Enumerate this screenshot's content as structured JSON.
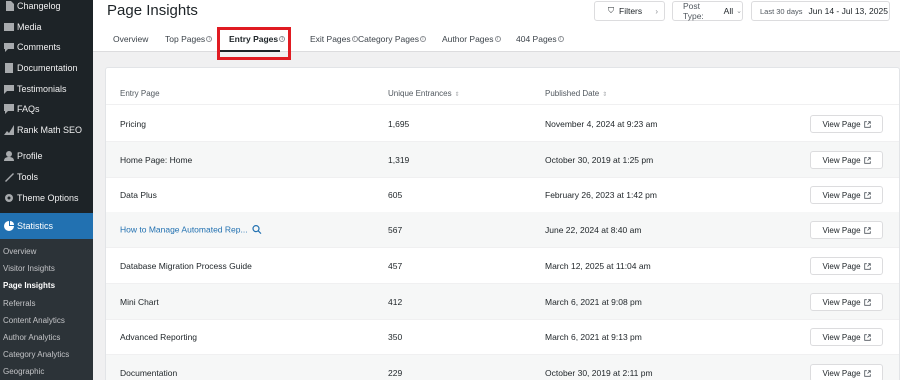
{
  "sidebar": {
    "items": [
      {
        "label": "Changelog",
        "icon": "changelog-icon"
      },
      {
        "label": "Media",
        "icon": "media-icon"
      },
      {
        "label": "Comments",
        "icon": "comments-icon"
      },
      {
        "label": "Documentation",
        "icon": "documentation-icon"
      },
      {
        "label": "Testimonials",
        "icon": "testimonials-icon"
      },
      {
        "label": "FAQs",
        "icon": "faqs-icon"
      },
      {
        "label": "Rank Math SEO",
        "icon": "rank-math-icon"
      },
      {
        "label": "Profile",
        "icon": "profile-icon"
      },
      {
        "label": "Tools",
        "icon": "tools-icon"
      },
      {
        "label": "Theme Options",
        "icon": "gear-icon"
      }
    ],
    "active": {
      "label": "Statistics",
      "icon": "statistics-icon"
    },
    "submenu": [
      "Overview",
      "Visitor Insights",
      "Page Insights",
      "Referrals",
      "Content Analytics",
      "Author Analytics",
      "Category Analytics",
      "Geographic"
    ],
    "current_submenu": "Page Insights"
  },
  "header": {
    "title": "Page Insights",
    "filters_label": "Filters",
    "post_type_label": "Post Type:",
    "post_type_value": "All",
    "date_preset": "Last 30 days",
    "date_range": "Jun 14 - Jul 13, 2025"
  },
  "tabs": [
    {
      "label": "Overview",
      "info": false
    },
    {
      "label": "Top Pages",
      "info": true
    },
    {
      "label": "Entry Pages",
      "info": true,
      "active": true
    },
    {
      "label": "Exit Pages",
      "info": true
    },
    {
      "label": "Category Pages",
      "info": true
    },
    {
      "label": "Author Pages",
      "info": true
    },
    {
      "label": "404 Pages",
      "info": true
    }
  ],
  "table": {
    "columns": [
      "Entry Page",
      "Unique Entrances",
      "Published Date"
    ],
    "view_label": "View Page",
    "rows": [
      {
        "page": "Pricing",
        "entrances": "1,695",
        "date": "November 4, 2024 at 9:23 am"
      },
      {
        "page": "Home Page: Home",
        "entrances": "1,319",
        "date": "October 30, 2019 at 1:25 pm"
      },
      {
        "page": "Data Plus",
        "entrances": "605",
        "date": "February 26, 2023 at 1:42 pm"
      },
      {
        "page": "How to Manage Automated Rep...",
        "entrances": "567",
        "date": "June 22, 2024 at 8:40 am",
        "link": true
      },
      {
        "page": "Database Migration Process Guide",
        "entrances": "457",
        "date": "March 12, 2025 at 11:04 am"
      },
      {
        "page": "Mini Chart",
        "entrances": "412",
        "date": "March 6, 2021 at 9:08 pm"
      },
      {
        "page": "Advanced Reporting",
        "entrances": "350",
        "date": "March 6, 2021 at 9:13 pm"
      },
      {
        "page": "Documentation",
        "entrances": "229",
        "date": "October 30, 2019 at 2:11 pm"
      }
    ]
  },
  "colors": {
    "sidebar_bg": "#1d2327",
    "active_menu": "#2271b1",
    "highlight": "#e01b22",
    "link": "#2271b1"
  }
}
